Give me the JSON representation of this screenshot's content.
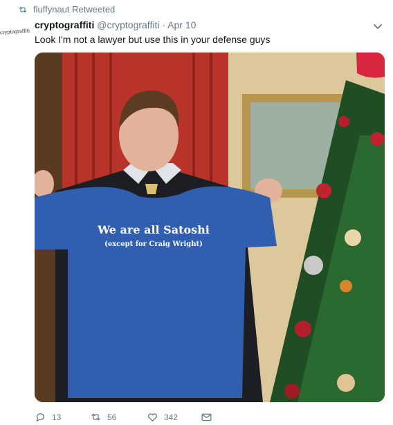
{
  "retweet_bar": {
    "text": "fluffynaut Retweeted",
    "icon": "retweet-icon"
  },
  "avatar": {
    "text": "cryptograffiti"
  },
  "tweet": {
    "name": "cryptograffiti",
    "handle": "@cryptograffiti",
    "separator": "·",
    "time": "Apr 10",
    "text": "Look I'm not a lawyer but use this in your defense guys",
    "media": {
      "shirt_line1": "We are all Satoshi",
      "shirt_line2": "(except for Craig Wright)"
    }
  },
  "actions": {
    "reply_count": "13",
    "retweet_count": "56",
    "like_count": "342"
  },
  "colors": {
    "muted": "#657786",
    "text": "#14171a",
    "shirt": "#2f5fae",
    "curtain": "#b8342a",
    "tree": "#1f4d24"
  }
}
